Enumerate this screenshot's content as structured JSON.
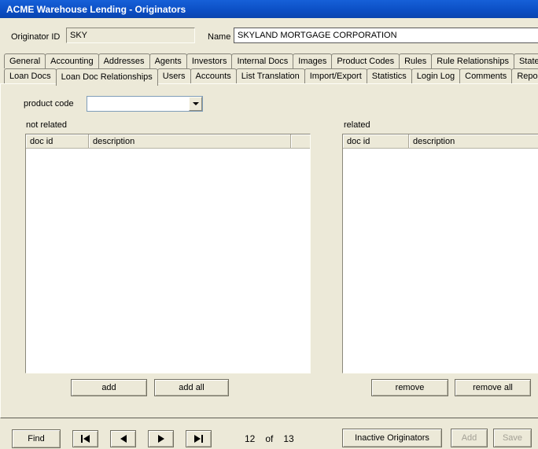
{
  "window": {
    "title": "ACME Warehouse Lending - Originators"
  },
  "header": {
    "originator_id_label": "Originator ID",
    "originator_id_value": "SKY",
    "name_label": "Name",
    "name_value": "SKYLAND MORTGAGE CORPORATION"
  },
  "tabs": {
    "row1": [
      "General",
      "Accounting",
      "Addresses",
      "Agents",
      "Investors",
      "Internal Docs",
      "Images",
      "Product Codes",
      "Rules",
      "Rule Relationships",
      "State Lice"
    ],
    "row2": [
      "Loan Docs",
      "Loan Doc Relationships",
      "Users",
      "Accounts",
      "List Translation",
      "Import/Export",
      "Statistics",
      "Login Log",
      "Comments",
      "Reports"
    ],
    "active_tab": "Loan Doc Relationships"
  },
  "content": {
    "product_code_label": "product code",
    "product_code_value": "",
    "not_related": {
      "label": "not related",
      "columns": [
        "doc id",
        "description"
      ],
      "rows": []
    },
    "related": {
      "label": "related",
      "columns": [
        "doc id",
        "description"
      ],
      "rows": []
    },
    "buttons": {
      "add": "add",
      "add_all": "add all",
      "remove": "remove",
      "remove_all": "remove all"
    }
  },
  "footer": {
    "find_label": "Find",
    "record_position": "12",
    "record_of_label": "of",
    "record_total": "13",
    "inactive_label": "Inactive Originators",
    "add_label": "Add",
    "save_label": "Save"
  },
  "icons": {
    "dropdown_arrow": "dropdown-arrow-icon",
    "first_record": "first-record-icon",
    "previous_record": "previous-record-icon",
    "next_record": "next-record-icon",
    "last_record": "last-record-icon"
  },
  "colors": {
    "titlebar_blue": "#0b4ec4",
    "window_background": "#ece9d8",
    "field_background": "#ffffff",
    "disabled_text": "#a3a095"
  }
}
